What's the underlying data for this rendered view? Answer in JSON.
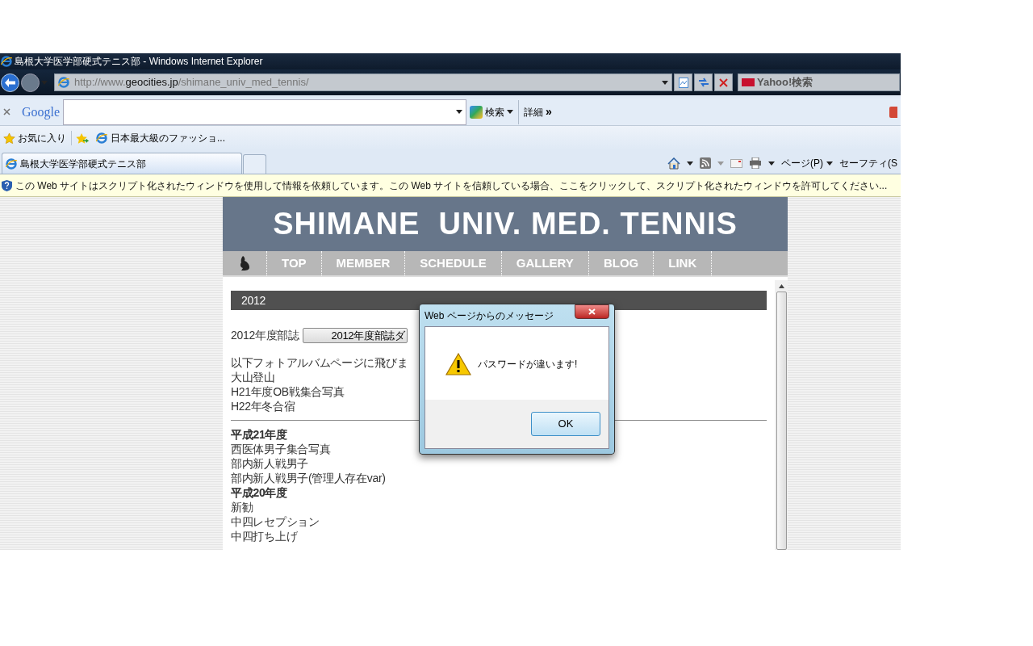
{
  "window": {
    "title": "島根大学医学部硬式テニス部 - Windows Internet Explorer"
  },
  "address_bar": {
    "url_prefix": "http://www.",
    "url_domain": "geocities.jp",
    "url_path": "/shimane_univ_med_tennis/"
  },
  "search_box": {
    "placeholder": "Yahoo!検索"
  },
  "google_toolbar": {
    "logo": "Google",
    "search_button": "検索",
    "more": "詳細",
    "more_glyph": "»"
  },
  "favorites_bar": {
    "favorites": "お気に入り",
    "links": [
      "日本最大級のファッショ..."
    ]
  },
  "tabs": [
    {
      "label": "島根大学医学部硬式テニス部",
      "selected": true
    }
  ],
  "command_bar": [
    "ページ(P)",
    "セーフティ(S"
  ],
  "info_bar": "この Web サイトはスクリプト化されたウィンドウを使用して情報を依頼しています。この Web サイトを信頼している場合、ここをクリックして、スクリプト化されたウィンドウを許可してください...",
  "site": {
    "title": "SHIMANE  UNIV. MED. TENNIS",
    "nav": [
      "TOP",
      "MEMBER",
      "SCHEDULE",
      "GALLERY",
      "BLOG",
      "LINK"
    ],
    "section": "2012",
    "items": [
      {
        "kind": "download",
        "label": "2012年度部誌",
        "button": "2012年度部誌ダ"
      },
      {
        "kind": "gap"
      },
      {
        "kind": "text",
        "text": "以下フォトアルバムページに飛びま"
      },
      {
        "kind": "text",
        "text": "大山登山"
      },
      {
        "kind": "text",
        "text": "H21年度OB戦集合写真"
      },
      {
        "kind": "text",
        "text": "H22年冬合宿"
      },
      {
        "kind": "rule"
      },
      {
        "kind": "heading",
        "text": "平成21年度"
      },
      {
        "kind": "text",
        "text": "西医体男子集合写真"
      },
      {
        "kind": "text",
        "text": "部内新人戦男子"
      },
      {
        "kind": "text",
        "text": "部内新人戦男子(管理人存在var)"
      },
      {
        "kind": "heading",
        "text": "平成20年度"
      },
      {
        "kind": "text",
        "text": "新勧"
      },
      {
        "kind": "text",
        "text": "中四レセプション"
      },
      {
        "kind": "text",
        "text": "中四打ち上げ"
      }
    ]
  },
  "dialog": {
    "title": "Web ページからのメッセージ",
    "message": "パスワードが違います!",
    "button": "OK"
  }
}
